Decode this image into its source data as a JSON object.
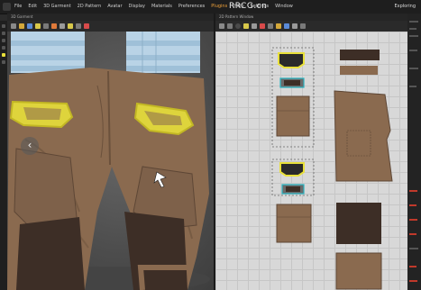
{
  "menubar": {
    "items": [
      "File",
      "Edit",
      "3D Garment",
      "2D Pattern",
      "Avatar",
      "Display",
      "Materials",
      "Preferences",
      "Plugins",
      "Help",
      "Settings",
      "Window"
    ],
    "active_index": 8,
    "brand": "RRCG.cn",
    "right_label": "Exploring"
  },
  "panels": {
    "view3d_title": "3D Garment",
    "view2d_title": "2D Pattern Window"
  },
  "colors": {
    "accent": "#f0a23b",
    "pocket_yellow": "#e8e03a",
    "fabric_brown": "#8a6a4f",
    "dark_fabric": "#3d2e26"
  },
  "icons": {
    "nav_left": "‹"
  }
}
